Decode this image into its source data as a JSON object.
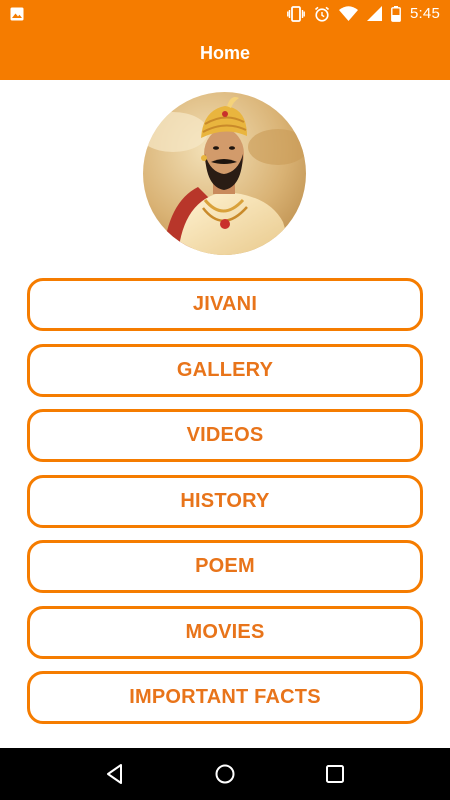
{
  "status_bar": {
    "time": "5:45",
    "icons": [
      "image-notification-icon",
      "vibrate-icon",
      "alarm-icon",
      "wifi-icon",
      "signal-icon",
      "battery-icon"
    ]
  },
  "app_bar": {
    "title": "Home"
  },
  "avatar": {
    "icon": "portrait-avatar"
  },
  "menu": {
    "items": [
      {
        "label": "JIVANI"
      },
      {
        "label": "GALLERY"
      },
      {
        "label": "VIDEOS"
      },
      {
        "label": "HISTORY"
      },
      {
        "label": "POEM"
      },
      {
        "label": "MOVIES"
      },
      {
        "label": "IMPORTANT FACTS"
      }
    ]
  },
  "navigation_bar": {
    "buttons": [
      "back-icon",
      "home-icon",
      "recents-icon"
    ]
  },
  "colors": {
    "accent": "#f57c00",
    "button_text": "#e8741a",
    "background": "#ffffff",
    "nav_bar": "#000000"
  }
}
